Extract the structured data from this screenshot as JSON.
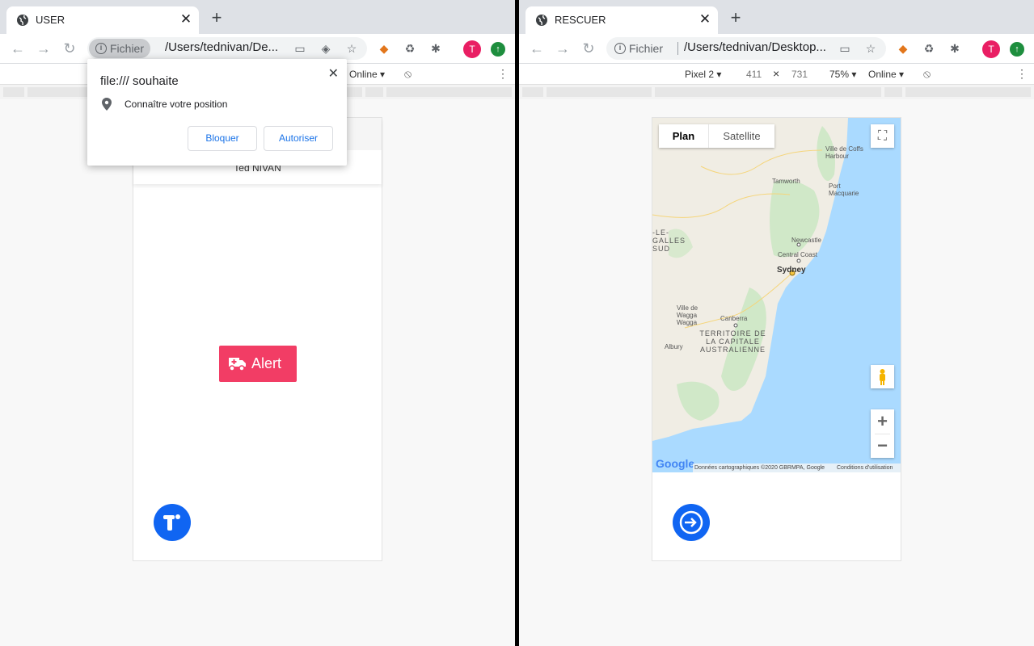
{
  "left_window": {
    "tab_title": "USER",
    "chip_label": "Fichier",
    "url": "/Users/tednivan/De...",
    "devtools": {
      "network": "Online ▾"
    },
    "app": {
      "header_name": "Ted NIVAN",
      "alert_label": "Alert"
    },
    "permission_popup": {
      "title": "file:/// souhaite",
      "request": "Connaître votre position",
      "block_label": "Bloquer",
      "allow_label": "Autoriser"
    },
    "profile_initial": "T"
  },
  "right_window": {
    "tab_title": "RESCUER",
    "chip_label": "Fichier",
    "url": "/Users/tednivan/Desktop...",
    "devtools": {
      "device": "Pixel 2 ▾",
      "width": "411",
      "times": "×",
      "height": "731",
      "zoom": "75% ▾",
      "network": "Online ▾"
    },
    "map": {
      "tab_plan": "Plan",
      "tab_satellite": "Satellite",
      "labels": [
        "Ville de Coffs Harbour",
        "Tamworth",
        "Port Macquarie",
        "-LE-GALLES SUD",
        "Newcastle",
        "Central Coast",
        "Sydney",
        "Ville de Wagga Wagga",
        "Canberra",
        "TERRITOIRE DE LA CAPITALE AUSTRALIENNE",
        "Albury"
      ],
      "google_logo": "Google",
      "attribution": "Données cartographiques ©2020 GBRMPA, Google",
      "terms": "Conditions d'utilisation",
      "zoom_in": "+",
      "zoom_out": "−"
    },
    "profile_initial": "T"
  },
  "colors": {
    "accent": "#1065f2",
    "alert": "#f23d65",
    "sea": "#aadaff",
    "land": "#f0ede4",
    "park": "#c8e6c0"
  }
}
